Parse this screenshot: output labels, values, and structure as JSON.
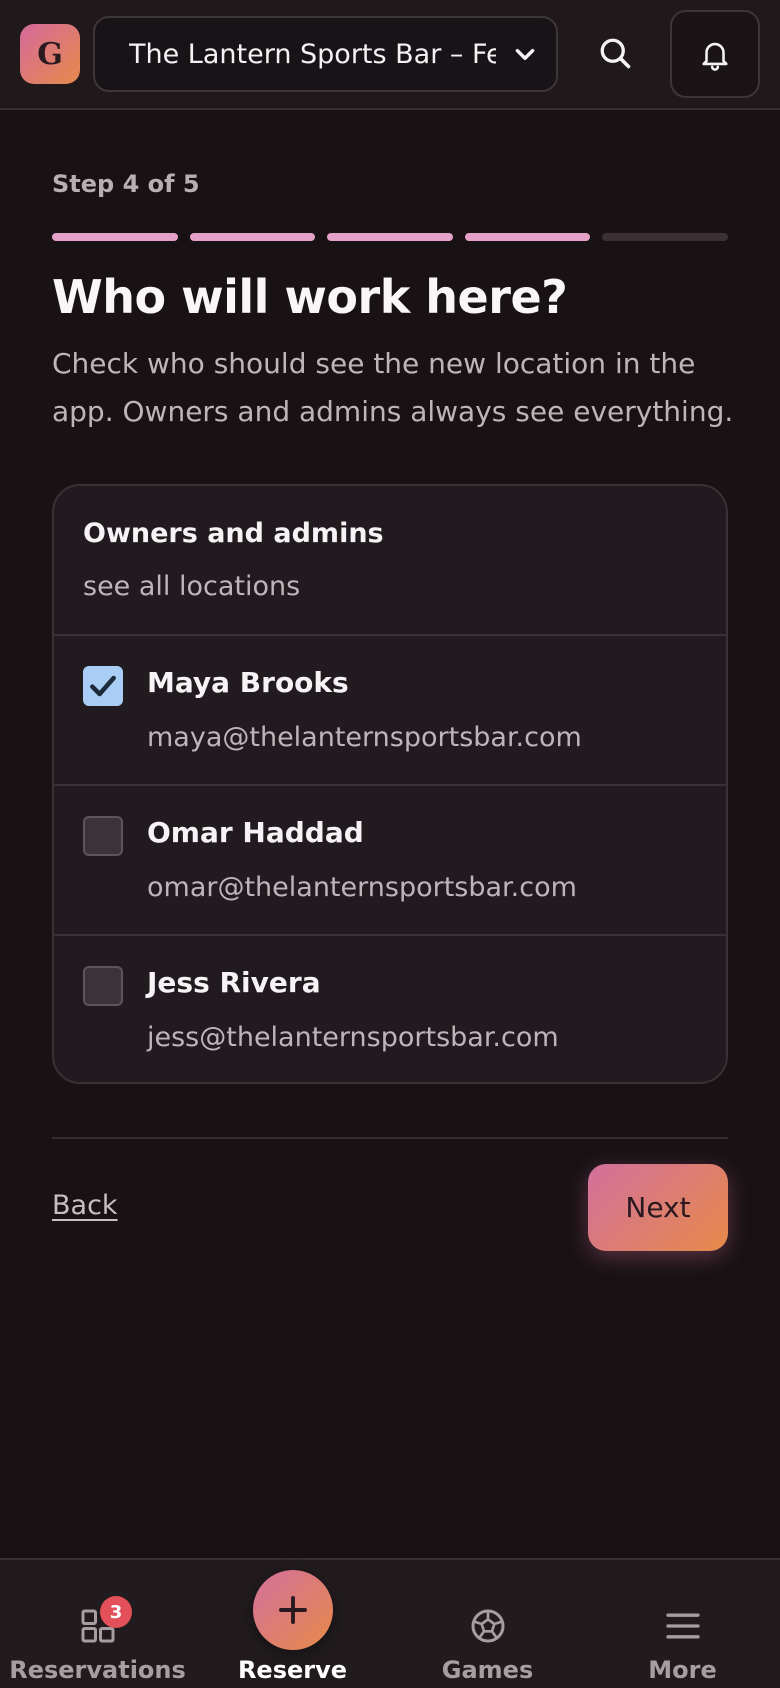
{
  "header": {
    "logo_letter": "G",
    "location_select": {
      "selected": "The Lantern Sports Bar – Fe"
    },
    "search_icon": "search-icon",
    "bell_icon": "bell-icon"
  },
  "wizard": {
    "step_label": "Step 4 of 5",
    "progress": {
      "current": 4,
      "total": 5
    },
    "title": "Who will work here?",
    "subtitle": "Check who should see the new location in the app. Owners and admins always see everything."
  },
  "card": {
    "heading": "Owners and admins",
    "subheading": "see all locations",
    "members": [
      {
        "name": "Maya Brooks",
        "email": "maya@thelanternsportsbar.com",
        "checked": true
      },
      {
        "name": "Omar Haddad",
        "email": "omar@thelanternsportsbar.com",
        "checked": false
      },
      {
        "name": "Jess Rivera",
        "email": "jess@thelanternsportsbar.com",
        "checked": false
      }
    ]
  },
  "actions": {
    "back_label": "Back",
    "next_label": "Next"
  },
  "bottom_nav": {
    "items": [
      {
        "label": "Reservations",
        "icon": "grid-icon",
        "badge": "3"
      },
      {
        "label": "Reserve",
        "icon": "plus-icon",
        "active": true
      },
      {
        "label": "Games",
        "icon": "soccer-ball-icon"
      },
      {
        "label": "More",
        "icon": "menu-icon"
      }
    ]
  },
  "colors": {
    "accent_start": "#d2709e",
    "accent_end": "#e68a48",
    "progress_done": "#e4a1c7",
    "checkbox_checked": "#a9cdf5",
    "badge": "#e4505a"
  }
}
